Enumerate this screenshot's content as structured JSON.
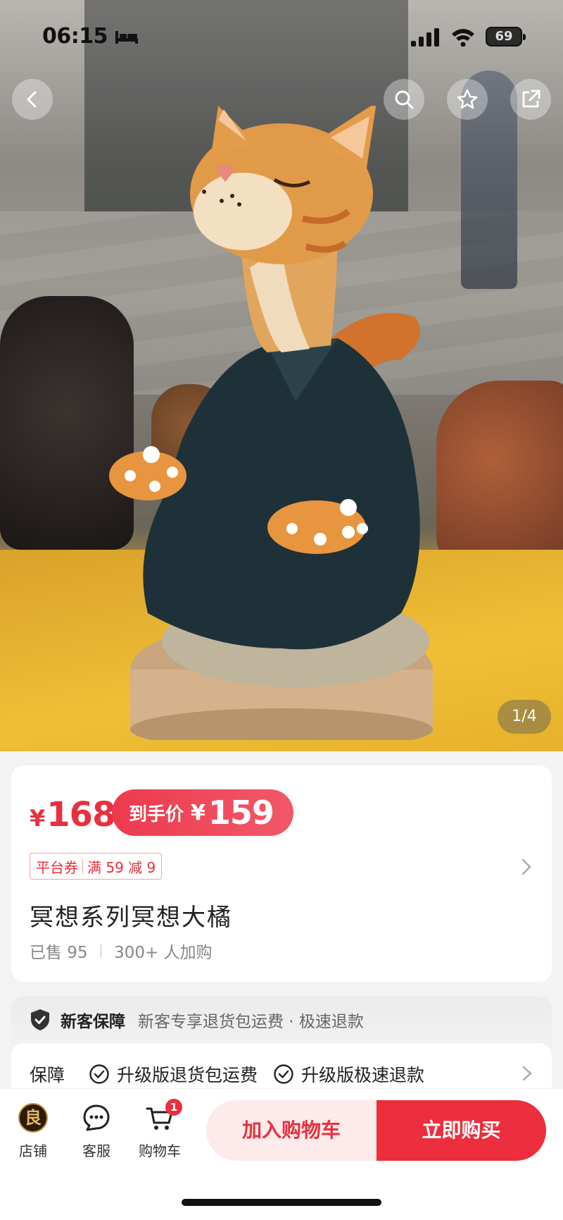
{
  "status_bar": {
    "time": "06:15",
    "battery": "69"
  },
  "gallery": {
    "counter": "1/4"
  },
  "product": {
    "price_currency": "¥",
    "price": "168",
    "final_label": "到手价",
    "final_currency": "¥",
    "final_price": "159",
    "coupon_tag": "平台券",
    "coupon_rule": "满 59 减 9",
    "title": "冥想系列冥想大橘",
    "sold": "已售 95",
    "cart_adds": "300+ 人加购"
  },
  "guarantee": {
    "title": "新客保障",
    "desc": "新客专享退货包运费 · 极速退款",
    "label": "保障",
    "items": [
      "升级版退货包运费",
      "升级版极速退款"
    ]
  },
  "bottom_bar": {
    "shop_logo_char": "良",
    "shop": "店铺",
    "service": "客服",
    "cart": "购物车",
    "cart_badge": "1",
    "add_to_cart": "加入购物车",
    "buy_now": "立即购买"
  },
  "colors": {
    "accent": "#ec2e3e",
    "accent_light": "#fdeaea",
    "card_bg": "#ffffff",
    "page_bg": "#f3f3f3"
  },
  "icons": [
    "back-icon",
    "search-icon",
    "star-icon",
    "share-icon",
    "shield-icon",
    "check-circle-icon",
    "chevron-right-icon",
    "chat-icon",
    "cart-icon"
  ]
}
